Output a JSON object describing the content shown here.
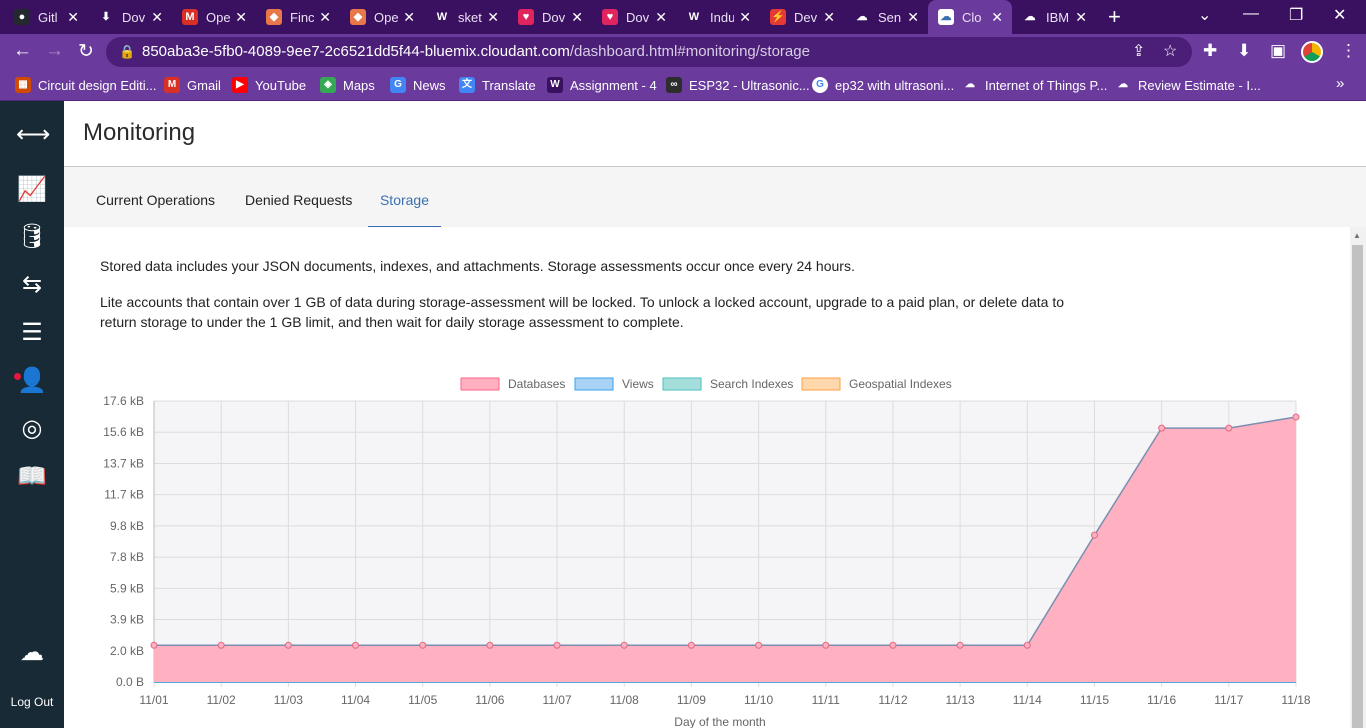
{
  "browser": {
    "tabs": [
      {
        "title": "GitHub",
        "short": "Gitl",
        "icon": "github-icon",
        "color": "#24292e",
        "glyph": "●"
      },
      {
        "title": "Downloads",
        "short": "Dov",
        "icon": "download-icon",
        "color": "#3a1160",
        "glyph": "⬇"
      },
      {
        "title": "Open Gmail",
        "short": "Ope",
        "icon": "gmail-icon",
        "color": "#d93025",
        "glyph": "M"
      },
      {
        "title": "Find",
        "short": "Finc",
        "icon": "helmet-icon",
        "color": "#e8774a",
        "glyph": "◆"
      },
      {
        "title": "Open",
        "short": "Ope",
        "icon": "helmet-icon",
        "color": "#e8774a",
        "glyph": "◆"
      },
      {
        "title": "sketch",
        "short": "sket",
        "icon": "wikipedia-icon",
        "color": "#3a1160",
        "glyph": "W"
      },
      {
        "title": "Download",
        "short": "Dov",
        "icon": "heart-icon",
        "color": "#e0245e",
        "glyph": "♥"
      },
      {
        "title": "Download",
        "short": "Dov",
        "icon": "heart-icon",
        "color": "#e0245e",
        "glyph": "♥"
      },
      {
        "title": "Industry",
        "short": "Indu",
        "icon": "wikipedia-icon",
        "color": "#3a1160",
        "glyph": "W"
      },
      {
        "title": "Dev",
        "short": "Dev",
        "icon": "lightning-icon",
        "color": "#e53935",
        "glyph": "⚡"
      },
      {
        "title": "Services",
        "short": "Sen",
        "icon": "ibm-cloud-icon",
        "color": "#3a1160",
        "glyph": "☁"
      },
      {
        "title": "Cloudant",
        "short": "Clo",
        "icon": "cloudant-icon",
        "color": "#ffffff",
        "glyph": "☁",
        "active": true
      },
      {
        "title": "IBM",
        "short": "IBM",
        "icon": "ibm-icon",
        "color": "#3a1160",
        "glyph": "☁"
      }
    ],
    "url_host": "850aba3e-5fb0-4089-9ee7-2c6521dd5f44-bluemix.cloudant.com",
    "url_path": "/dashboard.html#monitoring/storage",
    "bookmarks": [
      {
        "label": "Circuit design Editi...",
        "icon": "circuit-icon",
        "color": "#d04a02",
        "glyph": "▦"
      },
      {
        "label": "Gmail",
        "icon": "gmail-icon",
        "color": "#d93025",
        "glyph": "M"
      },
      {
        "label": "YouTube",
        "icon": "youtube-icon",
        "color": "#ff0000",
        "glyph": "▶"
      },
      {
        "label": "Maps",
        "icon": "maps-icon",
        "color": "#34a853",
        "glyph": "◈"
      },
      {
        "label": "News",
        "icon": "news-icon",
        "color": "#4285f4",
        "glyph": "G"
      },
      {
        "label": "Translate",
        "icon": "translate-icon",
        "color": "#4285f4",
        "glyph": "文"
      },
      {
        "label": "Assignment - 4",
        "icon": "wikipedia-icon",
        "color": "#3a1160",
        "glyph": "W"
      },
      {
        "label": "ESP32 - Ultrasonic...",
        "icon": "esp32-icon",
        "color": "#2d2d2d",
        "glyph": "∞"
      },
      {
        "label": "ep32 with ultrasoni...",
        "icon": "google-icon",
        "color": "#ffffff",
        "glyph": "G"
      },
      {
        "label": "Internet of Things P...",
        "icon": "ibm-cloud-icon",
        "color": "#6a3a9c",
        "glyph": "☁"
      },
      {
        "label": "Review Estimate - I...",
        "icon": "ibm-cloud-icon",
        "color": "#6a3a9c",
        "glyph": "☁"
      }
    ]
  },
  "rail": {
    "items": [
      {
        "name": "expand-collapse-icon",
        "glyph": "⟷"
      },
      {
        "name": "monitoring-icon",
        "glyph": "📈",
        "active": true
      },
      {
        "name": "databases-icon",
        "glyph": "🛢"
      },
      {
        "name": "replication-icon",
        "glyph": "⇆"
      },
      {
        "name": "active-tasks-icon",
        "glyph": "☰"
      },
      {
        "name": "account-icon",
        "glyph": "👤"
      },
      {
        "name": "support-icon",
        "glyph": "◎"
      },
      {
        "name": "documentation-icon",
        "glyph": "📖"
      },
      {
        "name": "cloud-account-icon",
        "glyph": "☁"
      }
    ],
    "logout_label": "Log Out"
  },
  "page": {
    "title": "Monitoring",
    "tabs": [
      {
        "label": "Current Operations"
      },
      {
        "label": "Denied Requests"
      },
      {
        "label": "Storage",
        "active": true
      }
    ],
    "desc1": "Stored data includes your JSON documents, indexes, and attachments. Storage assessments occur once every 24 hours.",
    "desc2": "Lite accounts that contain over 1 GB of data during storage-assessment will be locked. To unlock a locked account, upgrade to a paid plan, or delete data to return storage to under the 1 GB limit, and then wait for daily storage assessment to complete."
  },
  "chart_data": {
    "type": "area",
    "title": "",
    "xlabel": "Day of the month",
    "ylabel": "",
    "categories": [
      "11/01",
      "11/02",
      "11/03",
      "11/04",
      "11/05",
      "11/06",
      "11/07",
      "11/08",
      "11/09",
      "11/10",
      "11/11",
      "11/12",
      "11/13",
      "11/14",
      "11/15",
      "11/16",
      "11/17",
      "11/18"
    ],
    "y_ticks": [
      "0.0 B",
      "2.0 kB",
      "3.9 kB",
      "5.9 kB",
      "7.8 kB",
      "9.8 kB",
      "11.7 kB",
      "13.7 kB",
      "15.6 kB",
      "17.6 kB"
    ],
    "ylim_kb": [
      0,
      17.6
    ],
    "legend_position": "top",
    "grid": true,
    "series": [
      {
        "name": "Databases",
        "color": "#ff9fb4",
        "fill": "#ffb0c1",
        "line": "#ff6384",
        "values_kb": [
          2.3,
          2.3,
          2.3,
          2.3,
          2.3,
          2.3,
          2.3,
          2.3,
          2.3,
          2.3,
          2.3,
          2.3,
          2.3,
          2.3,
          9.2,
          15.9,
          15.9,
          16.6
        ]
      },
      {
        "name": "Views",
        "color": "#9ccaf0",
        "fill": "#a9d3f4",
        "line": "#36a2eb",
        "values_kb": [
          0,
          0,
          0,
          0,
          0,
          0,
          0,
          0,
          0,
          0,
          0,
          0,
          0,
          0,
          0,
          0,
          0,
          0
        ]
      },
      {
        "name": "Search Indexes",
        "color": "#a6dedb",
        "fill": "#a6dedb",
        "line": "#4bc0c0",
        "values_kb": [
          0,
          0,
          0,
          0,
          0,
          0,
          0,
          0,
          0,
          0,
          0,
          0,
          0,
          0,
          0,
          0,
          0,
          0
        ]
      },
      {
        "name": "Geospatial Indexes",
        "color": "#ffd7ad",
        "fill": "#ffd7ad",
        "line": "#ff9f40",
        "values_kb": [
          0,
          0,
          0,
          0,
          0,
          0,
          0,
          0,
          0,
          0,
          0,
          0,
          0,
          0,
          0,
          0,
          0,
          0
        ]
      }
    ]
  }
}
